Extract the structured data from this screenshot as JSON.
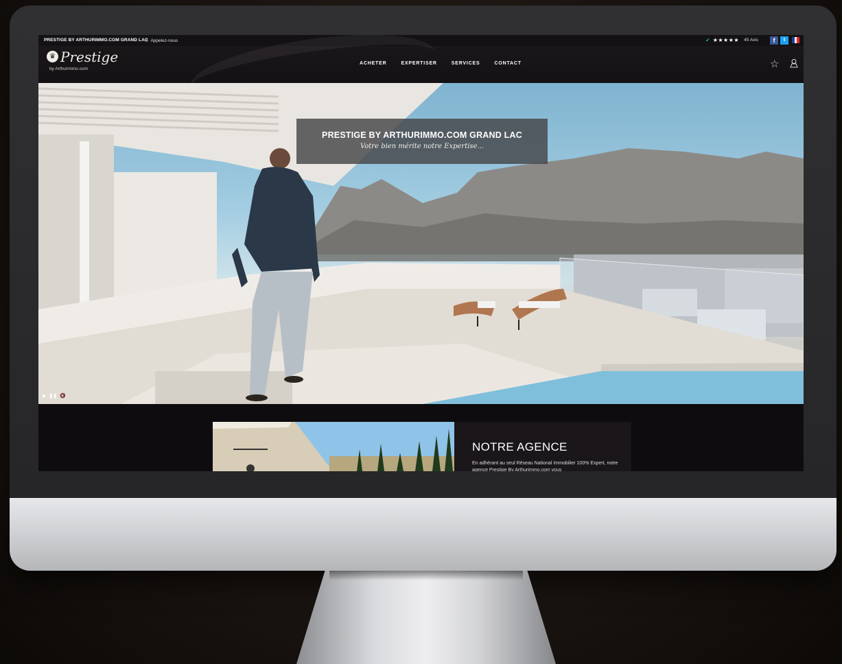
{
  "topbar": {
    "agency": "PRESTIGE BY ARTHURIMMO.COM GRAND LAC",
    "phone": "Appelez-nous",
    "stars": "★★★★★",
    "reviews": "45 Avis",
    "facebook": "f",
    "twitter": "t"
  },
  "logo": {
    "word": "Prestige",
    "sub": "by Arthurimmo.com"
  },
  "nav": {
    "items": [
      "ACHETER",
      "EXPERTISER",
      "SERVICES",
      "CONTACT"
    ]
  },
  "hero": {
    "title": "PRESTIGE BY ARTHURIMMO.COM GRAND LAC",
    "subtitle": "Votre bien mérite notre Expertise..."
  },
  "agency": {
    "heading": "NOTRE AGENCE",
    "text": "En adhérant au seul Réseau National Immobilier 100% Expert, notre agence Prestige By Arthurimmo.com vous"
  },
  "icons": {
    "phone": "phone-icon",
    "check": "check-icon",
    "star": "star-icon",
    "user": "user-icon",
    "play": "play-icon",
    "pause": "pause-icon",
    "mute": "mute-icon"
  },
  "colors": {
    "facebook": "#3b5998",
    "twitter": "#1da1f2",
    "accent": "#1fa7a0",
    "navbar": "#141114"
  }
}
